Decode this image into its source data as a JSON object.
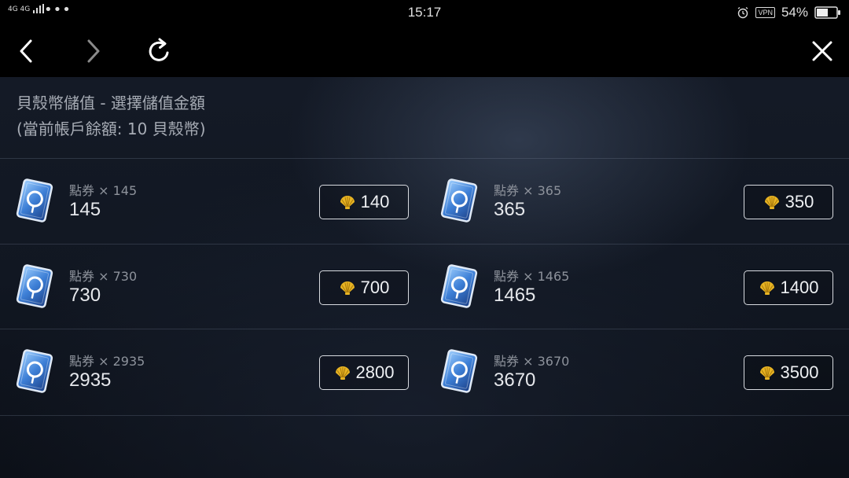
{
  "status_bar": {
    "signal": "4G 4G",
    "dots": "•••",
    "time": "15:17",
    "vpn": "VPN",
    "battery": "54%"
  },
  "nav": {
    "back_icon": "chevron-left-icon",
    "forward_icon": "chevron-right-icon",
    "refresh_icon": "refresh-icon",
    "close_icon": "close-icon"
  },
  "header": {
    "title": "貝殼幣儲值 - 選擇儲值金額",
    "balance": "(當前帳戶餘額: 10 貝殼幣)"
  },
  "items": [
    {
      "label": "點券 × 145",
      "amount": "145",
      "price": "140"
    },
    {
      "label": "點券 × 365",
      "amount": "365",
      "price": "350"
    },
    {
      "label": "點券 × 730",
      "amount": "730",
      "price": "700"
    },
    {
      "label": "點券 × 1465",
      "amount": "1465",
      "price": "1400"
    },
    {
      "label": "點券 × 2935",
      "amount": "2935",
      "price": "2800"
    },
    {
      "label": "點券 × 3670",
      "amount": "3670",
      "price": "3500"
    }
  ],
  "colors": {
    "shell": "#e8b423",
    "ticket": "#4a86d8"
  }
}
